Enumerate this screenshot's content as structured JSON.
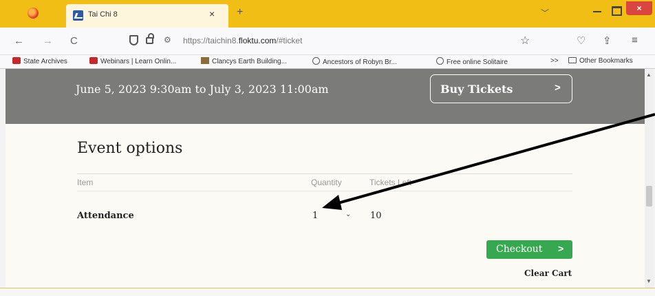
{
  "tab": {
    "title": "Tai Chi 8",
    "close": "×",
    "new_tab": "+"
  },
  "window": {
    "list_tabs": "﹀",
    "close": "×"
  },
  "nav": {
    "back": "←",
    "forward": "→",
    "reload": "C",
    "url_prefix": "https://taichin8.",
    "url_domain": "floktu.com",
    "url_suffix": "/#ticket",
    "bookmark_star": "☆",
    "pocket": "♡",
    "share": "⇪",
    "menu": "≡"
  },
  "bookmarks": {
    "items": [
      "State Archives",
      "Webinars | Learn Onlin...",
      "Clancys Earth Building...",
      "Ancestors of Robyn Br...",
      "Free online Solitaire"
    ],
    "overflow": ">>",
    "other": "Other Bookmarks"
  },
  "hero": {
    "date_range": "June 5, 2023 9:30am to July 3, 2023 11:00am",
    "buy_label": "Buy Tickets",
    "buy_chevron": ">"
  },
  "event": {
    "title": "Event options",
    "columns": {
      "item": "Item",
      "quantity": "Quantity",
      "tickets_left": "Tickets Left"
    },
    "row": {
      "item": "Attendance",
      "quantity": "1",
      "tickets_left": "10"
    },
    "select_chevron": "⌄",
    "checkout_label": "Checkout",
    "checkout_chevron": ">",
    "clear_cart": "Clear Cart"
  },
  "colors": {
    "accent": "#36a84f",
    "hero_bg": "#7b7b7a",
    "tabstrip": "#f0be14",
    "arrow": "#000000"
  }
}
